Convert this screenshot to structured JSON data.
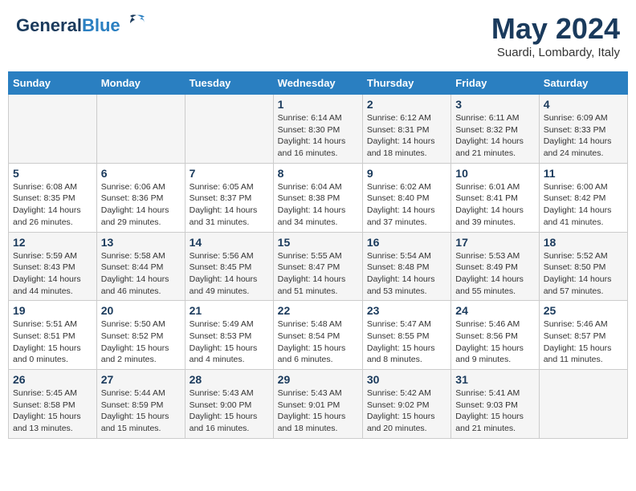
{
  "header": {
    "logo_general": "General",
    "logo_blue": "Blue",
    "month_title": "May 2024",
    "subtitle": "Suardi, Lombardy, Italy"
  },
  "days_of_week": [
    "Sunday",
    "Monday",
    "Tuesday",
    "Wednesday",
    "Thursday",
    "Friday",
    "Saturday"
  ],
  "weeks": [
    [
      {
        "day": "",
        "info": ""
      },
      {
        "day": "",
        "info": ""
      },
      {
        "day": "",
        "info": ""
      },
      {
        "day": "1",
        "info": "Sunrise: 6:14 AM\nSunset: 8:30 PM\nDaylight: 14 hours\nand 16 minutes."
      },
      {
        "day": "2",
        "info": "Sunrise: 6:12 AM\nSunset: 8:31 PM\nDaylight: 14 hours\nand 18 minutes."
      },
      {
        "day": "3",
        "info": "Sunrise: 6:11 AM\nSunset: 8:32 PM\nDaylight: 14 hours\nand 21 minutes."
      },
      {
        "day": "4",
        "info": "Sunrise: 6:09 AM\nSunset: 8:33 PM\nDaylight: 14 hours\nand 24 minutes."
      }
    ],
    [
      {
        "day": "5",
        "info": "Sunrise: 6:08 AM\nSunset: 8:35 PM\nDaylight: 14 hours\nand 26 minutes."
      },
      {
        "day": "6",
        "info": "Sunrise: 6:06 AM\nSunset: 8:36 PM\nDaylight: 14 hours\nand 29 minutes."
      },
      {
        "day": "7",
        "info": "Sunrise: 6:05 AM\nSunset: 8:37 PM\nDaylight: 14 hours\nand 31 minutes."
      },
      {
        "day": "8",
        "info": "Sunrise: 6:04 AM\nSunset: 8:38 PM\nDaylight: 14 hours\nand 34 minutes."
      },
      {
        "day": "9",
        "info": "Sunrise: 6:02 AM\nSunset: 8:40 PM\nDaylight: 14 hours\nand 37 minutes."
      },
      {
        "day": "10",
        "info": "Sunrise: 6:01 AM\nSunset: 8:41 PM\nDaylight: 14 hours\nand 39 minutes."
      },
      {
        "day": "11",
        "info": "Sunrise: 6:00 AM\nSunset: 8:42 PM\nDaylight: 14 hours\nand 41 minutes."
      }
    ],
    [
      {
        "day": "12",
        "info": "Sunrise: 5:59 AM\nSunset: 8:43 PM\nDaylight: 14 hours\nand 44 minutes."
      },
      {
        "day": "13",
        "info": "Sunrise: 5:58 AM\nSunset: 8:44 PM\nDaylight: 14 hours\nand 46 minutes."
      },
      {
        "day": "14",
        "info": "Sunrise: 5:56 AM\nSunset: 8:45 PM\nDaylight: 14 hours\nand 49 minutes."
      },
      {
        "day": "15",
        "info": "Sunrise: 5:55 AM\nSunset: 8:47 PM\nDaylight: 14 hours\nand 51 minutes."
      },
      {
        "day": "16",
        "info": "Sunrise: 5:54 AM\nSunset: 8:48 PM\nDaylight: 14 hours\nand 53 minutes."
      },
      {
        "day": "17",
        "info": "Sunrise: 5:53 AM\nSunset: 8:49 PM\nDaylight: 14 hours\nand 55 minutes."
      },
      {
        "day": "18",
        "info": "Sunrise: 5:52 AM\nSunset: 8:50 PM\nDaylight: 14 hours\nand 57 minutes."
      }
    ],
    [
      {
        "day": "19",
        "info": "Sunrise: 5:51 AM\nSunset: 8:51 PM\nDaylight: 15 hours\nand 0 minutes."
      },
      {
        "day": "20",
        "info": "Sunrise: 5:50 AM\nSunset: 8:52 PM\nDaylight: 15 hours\nand 2 minutes."
      },
      {
        "day": "21",
        "info": "Sunrise: 5:49 AM\nSunset: 8:53 PM\nDaylight: 15 hours\nand 4 minutes."
      },
      {
        "day": "22",
        "info": "Sunrise: 5:48 AM\nSunset: 8:54 PM\nDaylight: 15 hours\nand 6 minutes."
      },
      {
        "day": "23",
        "info": "Sunrise: 5:47 AM\nSunset: 8:55 PM\nDaylight: 15 hours\nand 8 minutes."
      },
      {
        "day": "24",
        "info": "Sunrise: 5:46 AM\nSunset: 8:56 PM\nDaylight: 15 hours\nand 9 minutes."
      },
      {
        "day": "25",
        "info": "Sunrise: 5:46 AM\nSunset: 8:57 PM\nDaylight: 15 hours\nand 11 minutes."
      }
    ],
    [
      {
        "day": "26",
        "info": "Sunrise: 5:45 AM\nSunset: 8:58 PM\nDaylight: 15 hours\nand 13 minutes."
      },
      {
        "day": "27",
        "info": "Sunrise: 5:44 AM\nSunset: 8:59 PM\nDaylight: 15 hours\nand 15 minutes."
      },
      {
        "day": "28",
        "info": "Sunrise: 5:43 AM\nSunset: 9:00 PM\nDaylight: 15 hours\nand 16 minutes."
      },
      {
        "day": "29",
        "info": "Sunrise: 5:43 AM\nSunset: 9:01 PM\nDaylight: 15 hours\nand 18 minutes."
      },
      {
        "day": "30",
        "info": "Sunrise: 5:42 AM\nSunset: 9:02 PM\nDaylight: 15 hours\nand 20 minutes."
      },
      {
        "day": "31",
        "info": "Sunrise: 5:41 AM\nSunset: 9:03 PM\nDaylight: 15 hours\nand 21 minutes."
      },
      {
        "day": "",
        "info": ""
      }
    ]
  ]
}
